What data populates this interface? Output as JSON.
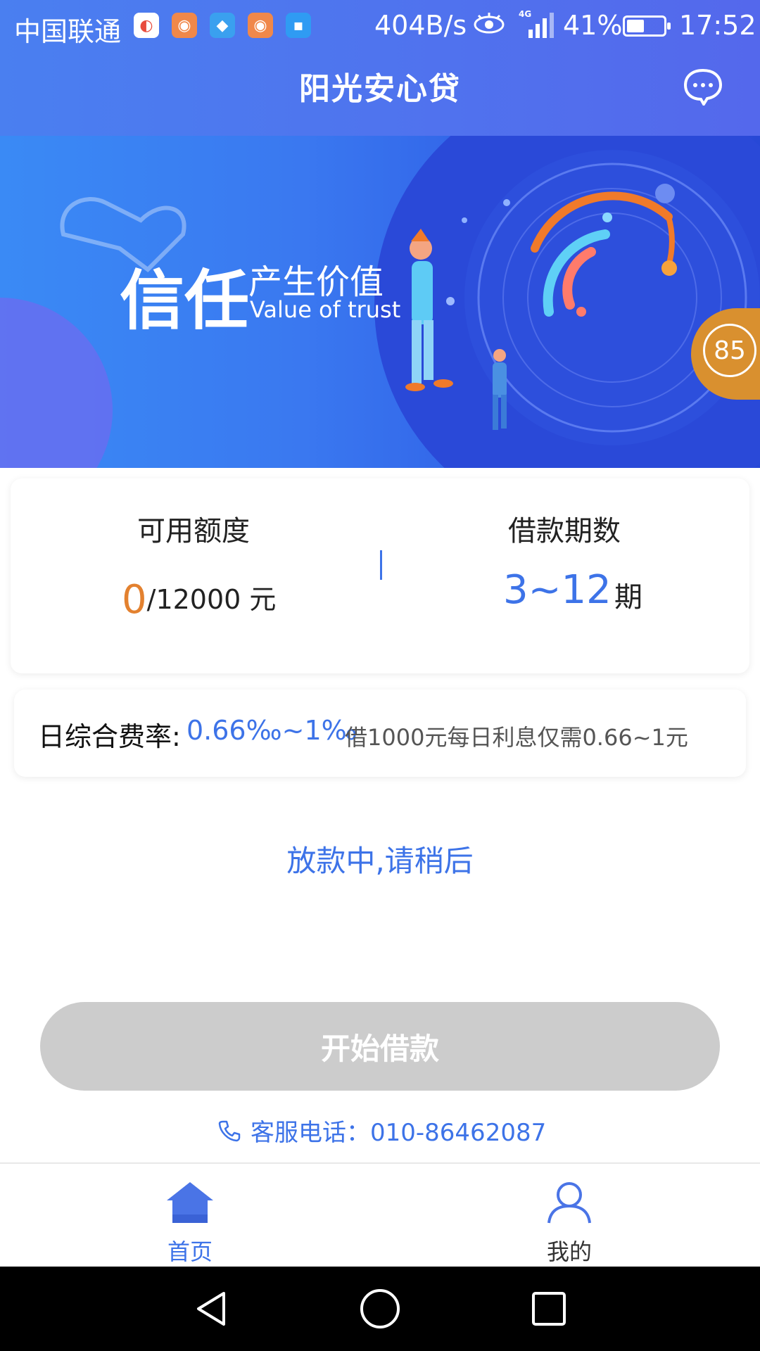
{
  "status_bar": {
    "carrier": "中国联通",
    "net_speed": "404B/s",
    "network": "4G",
    "battery": "41%",
    "battery_level": 0.41,
    "time": "17:52"
  },
  "header": {
    "title": "阳光安心贷",
    "message_icon": "chat-bubble-icon"
  },
  "banner": {
    "headline": "信任",
    "tagline_cn": "产生价值",
    "tagline_en": "Value of trust",
    "score": "85"
  },
  "limit_card": {
    "limit_label": "可用额度",
    "limit_used": "0",
    "limit_total": "/12000 元",
    "term_label": "借款期数",
    "term_range": "3~12",
    "term_unit": "期"
  },
  "rate_card": {
    "rate_label": "日综合费率:",
    "rate_value": "0.66‰~1‰",
    "rate_note": "借1000元每日利息仅需0.66~1元"
  },
  "status_message": "放款中,请稍后",
  "start_button": "开始借款",
  "hotline": "客服电话：010-86462087",
  "tabs": [
    {
      "label": "首页",
      "icon": "home-icon",
      "active": true
    },
    {
      "label": "我的",
      "icon": "user-icon",
      "active": false
    }
  ],
  "colors": {
    "accent": "#3d73e8",
    "highlight": "#e3812f",
    "disabled_button": "#cccccc"
  }
}
